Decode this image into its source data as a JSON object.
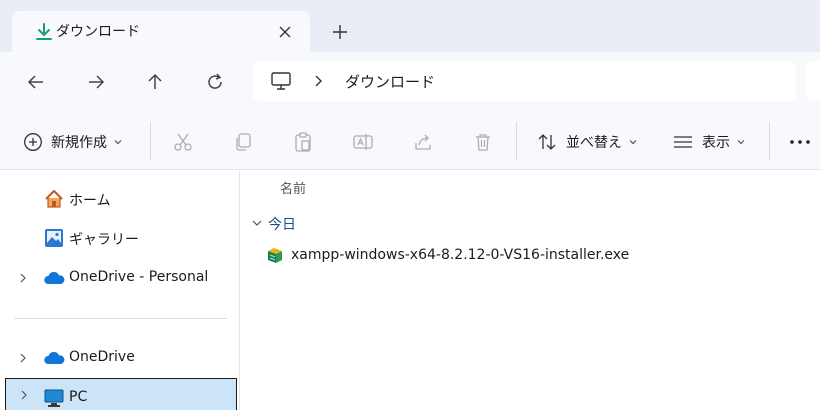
{
  "tab": {
    "title": "ダウンロード",
    "icon": "download-icon",
    "close_icon": "close-icon"
  },
  "newtab": {
    "icon": "plus-icon"
  },
  "nav": {
    "back_icon": "arrow-left-icon",
    "forward_icon": "arrow-right-icon",
    "up_icon": "arrow-up-icon",
    "refresh_icon": "refresh-icon"
  },
  "address": {
    "root_icon": "pc-icon",
    "path": "ダウンロード"
  },
  "commands": {
    "new_label": "新規作成",
    "sort_label": "並べ替え",
    "view_label": "表示",
    "more_icon": "more-icon"
  },
  "sidebar": {
    "items": [
      {
        "label": "ホーム",
        "icon": "home-icon"
      },
      {
        "label": "ギャラリー",
        "icon": "gallery-icon"
      },
      {
        "label": "OneDrive - Personal",
        "icon": "onedrive-icon"
      },
      {
        "label": "OneDrive",
        "icon": "onedrive-icon"
      },
      {
        "label": "PC",
        "icon": "pc-icon"
      }
    ]
  },
  "main": {
    "column_header": "名前",
    "group_label": "今日",
    "files": [
      {
        "name": "xampp-windows-x64-8.2.12-0-VS16-installer.exe",
        "icon": "installer-icon"
      }
    ]
  },
  "colors": {
    "accent": "#0067c0",
    "selected_bg": "#cce4f7",
    "chrome_bg": "#f7f9fc",
    "tabstrip_bg": "#e9eef6",
    "download_green": "#1f9b74"
  }
}
